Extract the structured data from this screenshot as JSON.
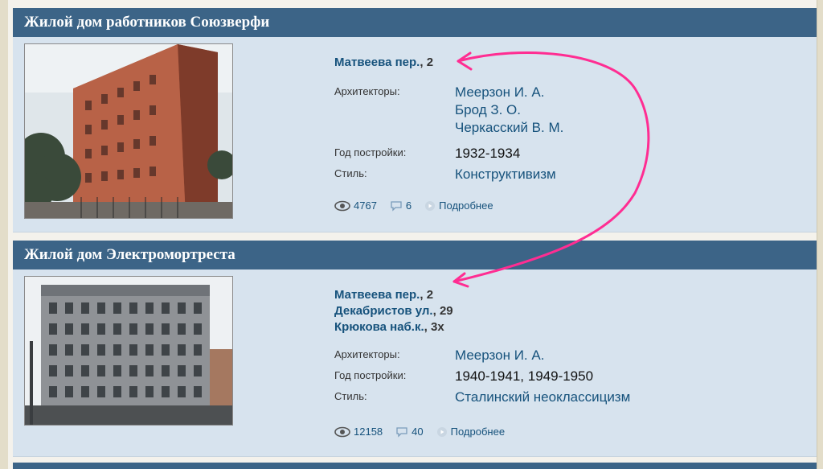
{
  "cards": [
    {
      "title": "Жилой дом работников Союзверфи",
      "addresses": [
        {
          "street": "Матвеева пер.",
          "number": "2"
        }
      ],
      "labels": {
        "architects": "Архитекторы:",
        "year": "Год постройки:",
        "style": "Стиль:"
      },
      "architects": [
        "Меерзон И. А.",
        "Брод З. О.",
        "Черкасский В. М."
      ],
      "year": "1932-1934",
      "style": "Конструктивизм",
      "views": "4767",
      "comments": "6",
      "more": "Подробнее"
    },
    {
      "title": "Жилой дом Электромортреста",
      "addresses": [
        {
          "street": "Матвеева пер.",
          "number": "2"
        },
        {
          "street": "Декабристов ул.",
          "number": "29"
        },
        {
          "street": "Крюкова наб.к.",
          "number": "3х"
        }
      ],
      "labels": {
        "architects": "Архитекторы:",
        "year": "Год постройки:",
        "style": "Стиль:"
      },
      "architects": [
        "Меерзон И. А."
      ],
      "year": "1940-1941, 1949-1950",
      "style": "Сталинский неоклассицизм",
      "views": "12158",
      "comments": "40",
      "more": "Подробнее"
    }
  ],
  "annotation": {
    "color": "#ff2d92",
    "icon": "curved-arrow"
  },
  "icons": {
    "views": "eye-icon",
    "comments": "speech-bubble-icon",
    "more": "play-circle-icon"
  }
}
